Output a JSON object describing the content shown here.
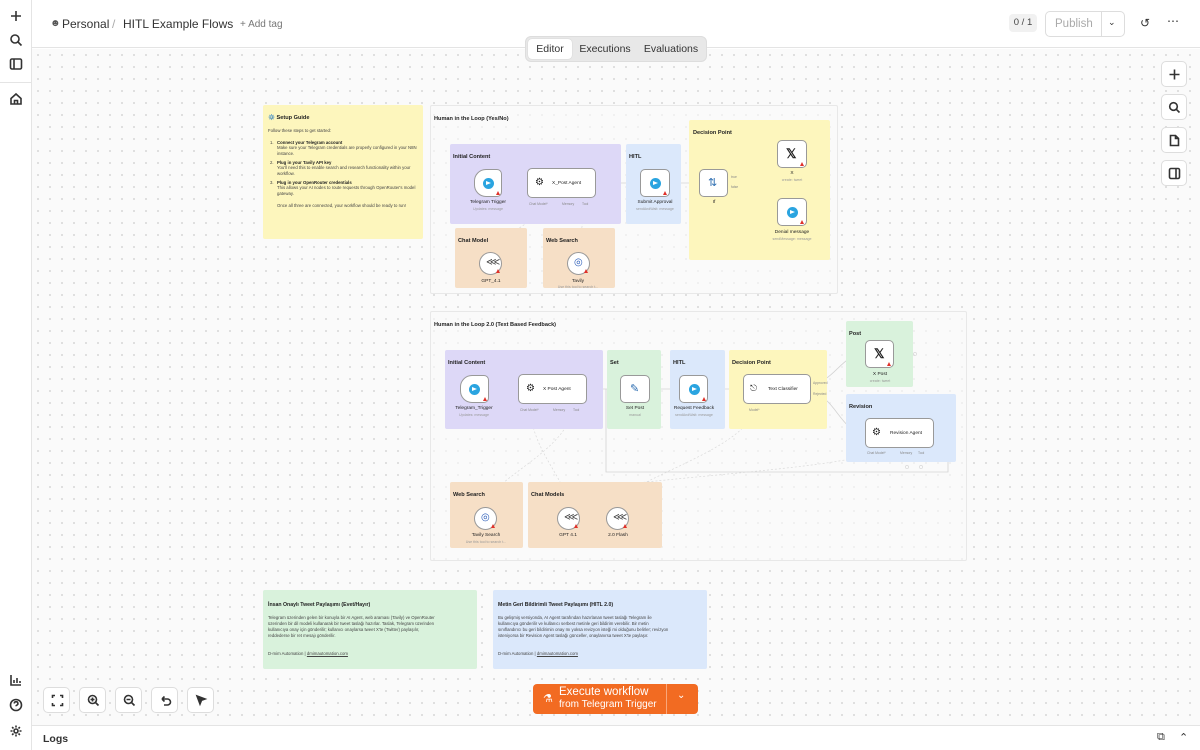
{
  "breadcrumb": {
    "owner": "Personal",
    "separator": "/",
    "workflow": "HITL Example Flows",
    "add_tag": "+ Add tag"
  },
  "header": {
    "counter": "0 / 1",
    "publish": "Publish"
  },
  "tabs": [
    {
      "label": "Editor",
      "active": true
    },
    {
      "label": "Executions"
    },
    {
      "label": "Evaluations"
    }
  ],
  "setup_guide": {
    "title": "⚙️ Setup Guide",
    "intro": "Follow these steps to get started:",
    "steps": [
      {
        "n": "1.",
        "head": "Connect your Telegram account",
        "body": "Make sure your Telegram credentials are properly configured in your N8N instance."
      },
      {
        "n": "2.",
        "head": "Plug in your Tavily API key",
        "body": "You'll need this to enable search and research functionality within your workflow."
      },
      {
        "n": "3.",
        "head": "Plug in your OpenRouter credentials",
        "body": "This allows your AI nodes to route requests through OpenRouter's model gateway."
      }
    ],
    "outro": "Once all three are connected, your workflow should be ready to run!"
  },
  "flow1": {
    "title": "Human in the Loop (Yes/No)",
    "sections": {
      "initial": "Initial Content",
      "hitl": "HITL",
      "decision": "Decision Point",
      "chat_model": "Chat Model",
      "web_search": "Web Search"
    },
    "nodes": {
      "telegram_trigger": {
        "label": "Telegram Trigger",
        "sub": "Updates: message"
      },
      "agent": {
        "label": "X_Post Agent"
      },
      "submit_approval": {
        "label": "Submit Approval",
        "sub": "sendAndWait: message"
      },
      "if": {
        "label": "If"
      },
      "x": {
        "label": "X",
        "sub": "create: tweet"
      },
      "denial": {
        "label": "Denial message",
        "sub": "sendMessage: message"
      },
      "gpt": {
        "label": "GPT_4.1"
      },
      "tavily": {
        "label": "Tavily",
        "sub": "Use this tool to search t..."
      }
    },
    "ports": {
      "chat_model": "Chat Model*",
      "memory": "Memory",
      "tool": "Tool",
      "true": "true",
      "false": "false"
    }
  },
  "flow2": {
    "title": "Human in the Loop 2.0 (Text Based Feedback)",
    "sections": {
      "initial": "Initial Content",
      "set": "Set",
      "hitl": "HITL",
      "decision": "Decision Point",
      "post": "Post",
      "revision": "Revision",
      "web_search": "Web Search",
      "chat_models": "Chat Models"
    },
    "nodes": {
      "telegram_trigger": {
        "label": "Telegram_Trigger",
        "sub": "Updates: message"
      },
      "agent": {
        "label": "X Post Agent"
      },
      "set_post": {
        "label": "Set Post",
        "sub": "manual"
      },
      "request_feedback": {
        "label": "Request Feedback",
        "sub": "sendAndWait: message"
      },
      "classifier": {
        "label": "Text Classifier"
      },
      "x_post": {
        "label": "X Post",
        "sub": "create: tweet"
      },
      "revision_agent": {
        "label": "Revision Agent"
      },
      "tavily_search": {
        "label": "Tavily Search",
        "sub": "Use this tool to search t..."
      },
      "gpt": {
        "label": "GPT 4.1"
      },
      "flash": {
        "label": "2.0 Flash"
      }
    },
    "ports": {
      "chat_model": "Chat Model*",
      "memory": "Memory",
      "tool": "Tool",
      "model": "Model*",
      "approved": "Approved",
      "rejected": "Rejected"
    }
  },
  "note_tr": {
    "title": "İnsan Onaylı Tweet Paylaşımı (Evet/Hayır)",
    "lines": [
      "Telegram üzerinden gelen bir konuyla bir AI Agent, web araması (Tavily) ve OpenRouter",
      "üzerinden bir dil modeli kullanarak bir tweet taslağı hazırlar. Taslak, Telegram üzerinden",
      "kullanıcıya onay için gönderilir; kullanıcı onaylarsa tweet X'te (Twitter) paylaşılır,",
      "reddederse bir ret mesajı gönderilir."
    ],
    "footer_prefix": "D-mim Automation | ",
    "footer_link": "dmimautomation.com"
  },
  "note_tr2": {
    "title": "Metin Geri Bildirimli Tweet Paylaşımı (HITL 2.0)",
    "lines": [
      "Bu gelişmiş versiyonda, AI Agent tarafından hazırlanan tweet taslağı Telegram ile",
      "kullanıcıya gönderilir ve kullanıcı serbest metinle geri bildirim verebilir. Bir metin",
      "sınıflandırıcı bu geri bildirimin onay mı yoksa revizyon isteği mi olduğunu belirler; revizyon",
      "isteniyorsa bir Revision Agent taslağı günceller, onaylanırsa tweet X'te paylaşır."
    ],
    "footer_prefix": "D-mim Automation | ",
    "footer_link": "dmimautomation.com"
  },
  "execute": {
    "label": "Execute workflow",
    "sub": "from Telegram Trigger"
  },
  "logs": {
    "label": "Logs"
  }
}
